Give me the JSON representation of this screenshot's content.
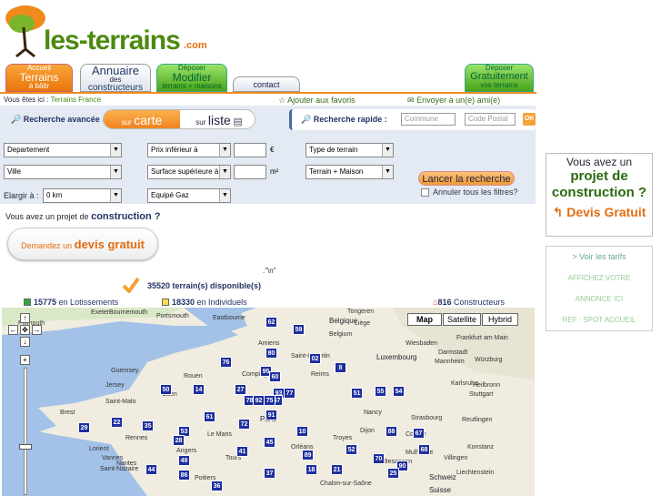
{
  "logo": {
    "name": "les-terrains",
    "domain": ".com"
  },
  "tabs": {
    "accueil": {
      "small": "Accueil",
      "big": "Terrains",
      "sub": "à bâtir"
    },
    "annuaire": {
      "big": "Annuaire",
      "small": "des",
      "sub": "constructeurs"
    },
    "deposer": {
      "small": "Déposer",
      "big": "Modifier",
      "sub": "terrains + maisons"
    },
    "contact": "contact",
    "gratuit": {
      "small": "Déposer",
      "big": "Gratuitement",
      "sub": "vos terrains"
    }
  },
  "breadcrumb": {
    "prefix": "Vous êtes ici :",
    "current": "Terrains France"
  },
  "actions": {
    "favorites": "Ajouter aux favoris",
    "send": "Envoyer à un(e) ami(e)"
  },
  "search": {
    "advanced_label": "Recherche avancée :",
    "view_carte_sm": "sur",
    "view_carte_lg": "carte",
    "view_liste_sm": "sur",
    "view_liste_lg": "liste",
    "quick_label": "Recherche rapide :",
    "commune_placeholder": "Commune",
    "postal_placeholder": "Code Postal",
    "ok": "OK",
    "departement": "Departement",
    "ville": "Ville",
    "elargir_label": "Elargir à :",
    "elargir_value": "0 km",
    "prix": "Prix inférieur à",
    "prix_unit": "€",
    "surface": "Surface supérieure à",
    "surface_unit": "m²",
    "equipe": "Equipé Gaz",
    "type": "Type de terrain",
    "type2": "Terrain + Maison",
    "launch": "Lancer la recherche",
    "cancel": "Annuler tous les filtres?"
  },
  "devis": {
    "question": "Vous avez un projet de",
    "question_bold": "construction ?",
    "btn_prefix": "Demandez un",
    "btn_bold": "devis gratuit"
  },
  "stray": ".\"\\n\"",
  "counts": {
    "total": "35520 terrain(s) disponible(s)",
    "lotissements_num": "15775",
    "lotissements_txt": "en Lotissements",
    "individuels_num": "18330",
    "individuels_txt": "en Individuels",
    "constructeurs_num": "816",
    "constructeurs_txt": "Constructeurs"
  },
  "map": {
    "types": [
      "Map",
      "Satellite",
      "Hybrid"
    ],
    "markers": [
      "62",
      "59",
      "76",
      "80",
      "02",
      "8",
      "50",
      "14",
      "27",
      "95",
      "60",
      "93",
      "77",
      "51",
      "55",
      "54",
      "57",
      "78",
      "92",
      "75",
      "91",
      "29",
      "22",
      "35",
      "53",
      "72",
      "28",
      "45",
      "10",
      "89",
      "52",
      "88",
      "68",
      "67",
      "44",
      "49",
      "41",
      "36",
      "21",
      "70",
      "90",
      "25",
      "86",
      "37",
      "18",
      "61"
    ],
    "places": [
      "Exeter",
      "Bournemouth",
      "Portsmouth",
      "Eastbourne",
      "Plymouth",
      "Tongeren",
      "Belgique",
      "Belgium",
      "Liège",
      "Wiesbaden",
      "Frankfurt am Main",
      "Darmstadt",
      "Mannheim",
      "Würzburg",
      "Amiens",
      "Saint-Quentin",
      "Luxembourg",
      "Guernsey",
      "Jersey",
      "Rouen",
      "Compiègne",
      "Reims",
      "Karlsruhe",
      "Stuttgart",
      "Heilbronn",
      "Caen",
      "Paris",
      "Nancy",
      "Strasbourg",
      "Reutlingen",
      "Brest",
      "Saint-Malo",
      "Rennes",
      "Le Mans",
      "Troyes",
      "Colmar",
      "Mulhouse",
      "Konstanz",
      "Angers",
      "Tours",
      "Orléans",
      "Dijon",
      "Besançon",
      "Schweiz",
      "Suisse",
      "Liechtenstein",
      "Saint-Nazaire",
      "Nantes",
      "Poitiers",
      "Chalon-sur-Saône",
      "Villingen",
      "Lorient",
      "Vannes"
    ]
  },
  "ads": {
    "devis_l1": "Vous avez un",
    "devis_l2": "projet de",
    "devis_l3": "construction ?",
    "devis_l4": "Devis Gratuit",
    "tarifs": "> Voir les tarifs",
    "affichez": "AFFICHEZ VOTRE",
    "annonce": "ANNONCE ICI",
    "ref": "REF : SPOT ACCUEIL"
  },
  "colors": {
    "orange": "#f08a1d",
    "green": "#4c8a10",
    "navy": "#223366",
    "marker": "#1e2f9e"
  }
}
